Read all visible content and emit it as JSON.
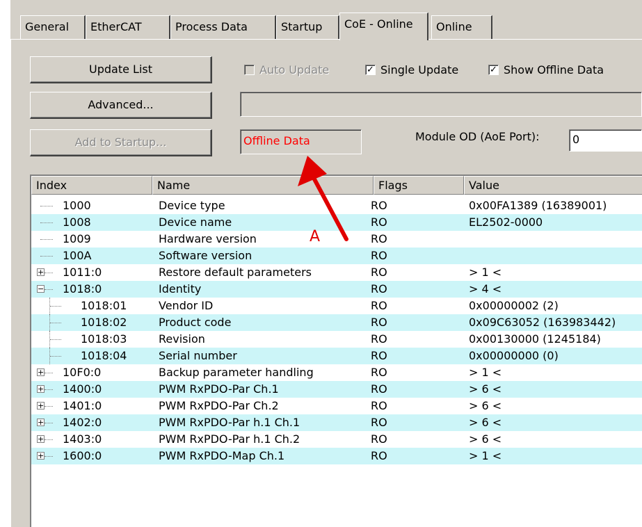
{
  "tabs": [
    {
      "label": "General",
      "active": false
    },
    {
      "label": "EtherCAT",
      "active": false
    },
    {
      "label": "Process Data",
      "active": false
    },
    {
      "label": "Startup",
      "active": false
    },
    {
      "label": "CoE - Online",
      "active": true
    },
    {
      "label": "Online",
      "active": false
    }
  ],
  "buttons": {
    "update_list": "Update List",
    "advanced": "Advanced...",
    "add_to_startup": "Add to Startup..."
  },
  "checkboxes": {
    "auto_update": {
      "label": "Auto Update",
      "checked": false,
      "enabled": false
    },
    "single_update": {
      "label": "Single Update",
      "checked": true
    },
    "show_offline": {
      "label": "Show Offline Data",
      "checked": true
    }
  },
  "status_field": {
    "text": "Offline Data",
    "color": "#ff0000"
  },
  "module_od": {
    "label": "Module OD (AoE Port):",
    "value": "0"
  },
  "annotation": {
    "label": "A",
    "color": "#e00000"
  },
  "columns": [
    "Index",
    "Name",
    "Flags",
    "Value"
  ],
  "rows": [
    {
      "index": "1000",
      "name": "Device type",
      "flags": "RO",
      "value": "0x00FA1389 (16389001)",
      "level": 0,
      "expander": null
    },
    {
      "index": "1008",
      "name": "Device name",
      "flags": "RO",
      "value": "EL2502-0000",
      "level": 0,
      "expander": null
    },
    {
      "index": "1009",
      "name": "Hardware version",
      "flags": "RO",
      "value": "",
      "level": 0,
      "expander": null
    },
    {
      "index": "100A",
      "name": "Software version",
      "flags": "RO",
      "value": "",
      "level": 0,
      "expander": null
    },
    {
      "index": "1011:0",
      "name": "Restore default parameters",
      "flags": "RO",
      "value": "> 1 <",
      "level": 0,
      "expander": "+"
    },
    {
      "index": "1018:0",
      "name": "Identity",
      "flags": "RO",
      "value": "> 4 <",
      "level": 0,
      "expander": "−"
    },
    {
      "index": "1018:01",
      "name": "Vendor ID",
      "flags": "RO",
      "value": "0x00000002 (2)",
      "level": 1,
      "expander": null
    },
    {
      "index": "1018:02",
      "name": "Product code",
      "flags": "RO",
      "value": "0x09C63052 (163983442)",
      "level": 1,
      "expander": null
    },
    {
      "index": "1018:03",
      "name": "Revision",
      "flags": "RO",
      "value": "0x00130000 (1245184)",
      "level": 1,
      "expander": null
    },
    {
      "index": "1018:04",
      "name": "Serial number",
      "flags": "RO",
      "value": "0x00000000 (0)",
      "level": 1,
      "expander": null
    },
    {
      "index": "10F0:0",
      "name": "Backup parameter handling",
      "flags": "RO",
      "value": "> 1 <",
      "level": 0,
      "expander": "+"
    },
    {
      "index": "1400:0",
      "name": "PWM RxPDO-Par Ch.1",
      "flags": "RO",
      "value": "> 6 <",
      "level": 0,
      "expander": "+"
    },
    {
      "index": "1401:0",
      "name": "PWM RxPDO-Par Ch.2",
      "flags": "RO",
      "value": "> 6 <",
      "level": 0,
      "expander": "+"
    },
    {
      "index": "1402:0",
      "name": "PWM RxPDO-Par h.1 Ch.1",
      "flags": "RO",
      "value": "> 6 <",
      "level": 0,
      "expander": "+"
    },
    {
      "index": "1403:0",
      "name": "PWM RxPDO-Par h.1 Ch.2",
      "flags": "RO",
      "value": "> 6 <",
      "level": 0,
      "expander": "+"
    },
    {
      "index": "1600:0",
      "name": "PWM RxPDO-Map Ch.1",
      "flags": "RO",
      "value": "> 1 <",
      "level": 0,
      "expander": "+"
    }
  ]
}
